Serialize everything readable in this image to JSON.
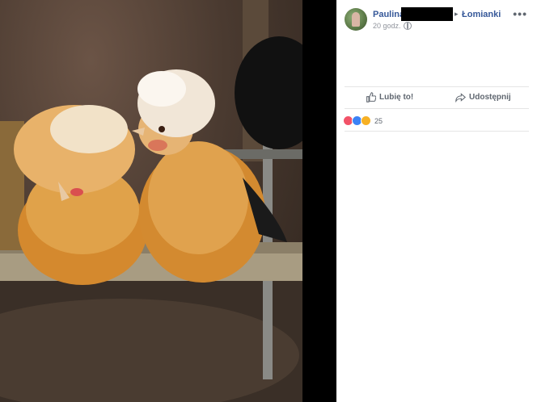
{
  "post": {
    "author_name": "Paulina",
    "location": "Łomianki",
    "time": "20 godz.",
    "more": "•••"
  },
  "actions": {
    "like": "Lubię to!",
    "share": "Udostępnij"
  },
  "reactions": {
    "count": "25",
    "types": [
      "love-icon",
      "like-icon",
      "wow-icon"
    ]
  },
  "colors": {
    "link": "#365899",
    "meta": "#90949c"
  }
}
